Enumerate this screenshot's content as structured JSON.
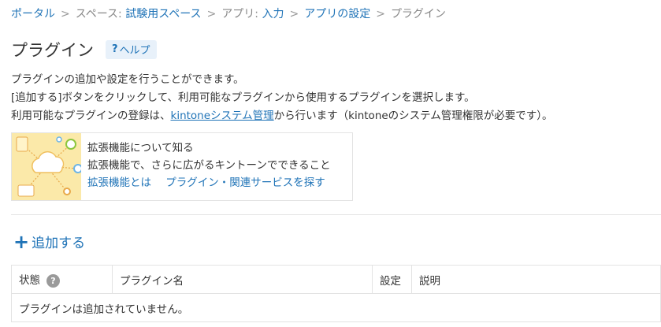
{
  "breadcrumb": {
    "items": [
      {
        "label": "ポータル",
        "link": true
      },
      {
        "label": "スペース: ",
        "link": false
      },
      {
        "label": "試験用スペース",
        "link": true
      },
      {
        "label": "アプリ: ",
        "link": false
      },
      {
        "label": "入力",
        "link": true
      },
      {
        "label": "アプリの設定",
        "link": true
      },
      {
        "label": "プラグイン",
        "link": false
      }
    ],
    "separator": ">"
  },
  "header": {
    "title": "プラグイン",
    "help_label": "ヘルプ",
    "help_icon": "?"
  },
  "description": {
    "line1": "プラグインの追加や設定を行うことができます。",
    "line2": "[追加する]ボタンをクリックして、利用可能なプラグインから使用するプラグインを選択します。",
    "line3_prefix": "利用可能なプラグインの登録は、",
    "line3_link": "kintoneシステム管理",
    "line3_suffix": "から行います（kintoneのシステム管理権限が必要です）。"
  },
  "promo": {
    "title": "拡張機能について知る",
    "subtitle": "拡張機能で、さらに広がるキントーンでできること",
    "link1": "拡張機能とは",
    "link2": "プラグイン・関連サービスを探す",
    "art_icon": "cloud-network-illustration"
  },
  "add_button": {
    "icon": "+",
    "label": "追加する"
  },
  "table": {
    "columns": [
      "状態",
      "プラグイン名",
      "設定",
      "説明"
    ],
    "status_help_icon": "?",
    "empty_message": "プラグインは追加されていません。"
  },
  "colors": {
    "link": "#1f73b7",
    "border": "#e3e3e3",
    "promo_bg": "#fbe9a9"
  }
}
